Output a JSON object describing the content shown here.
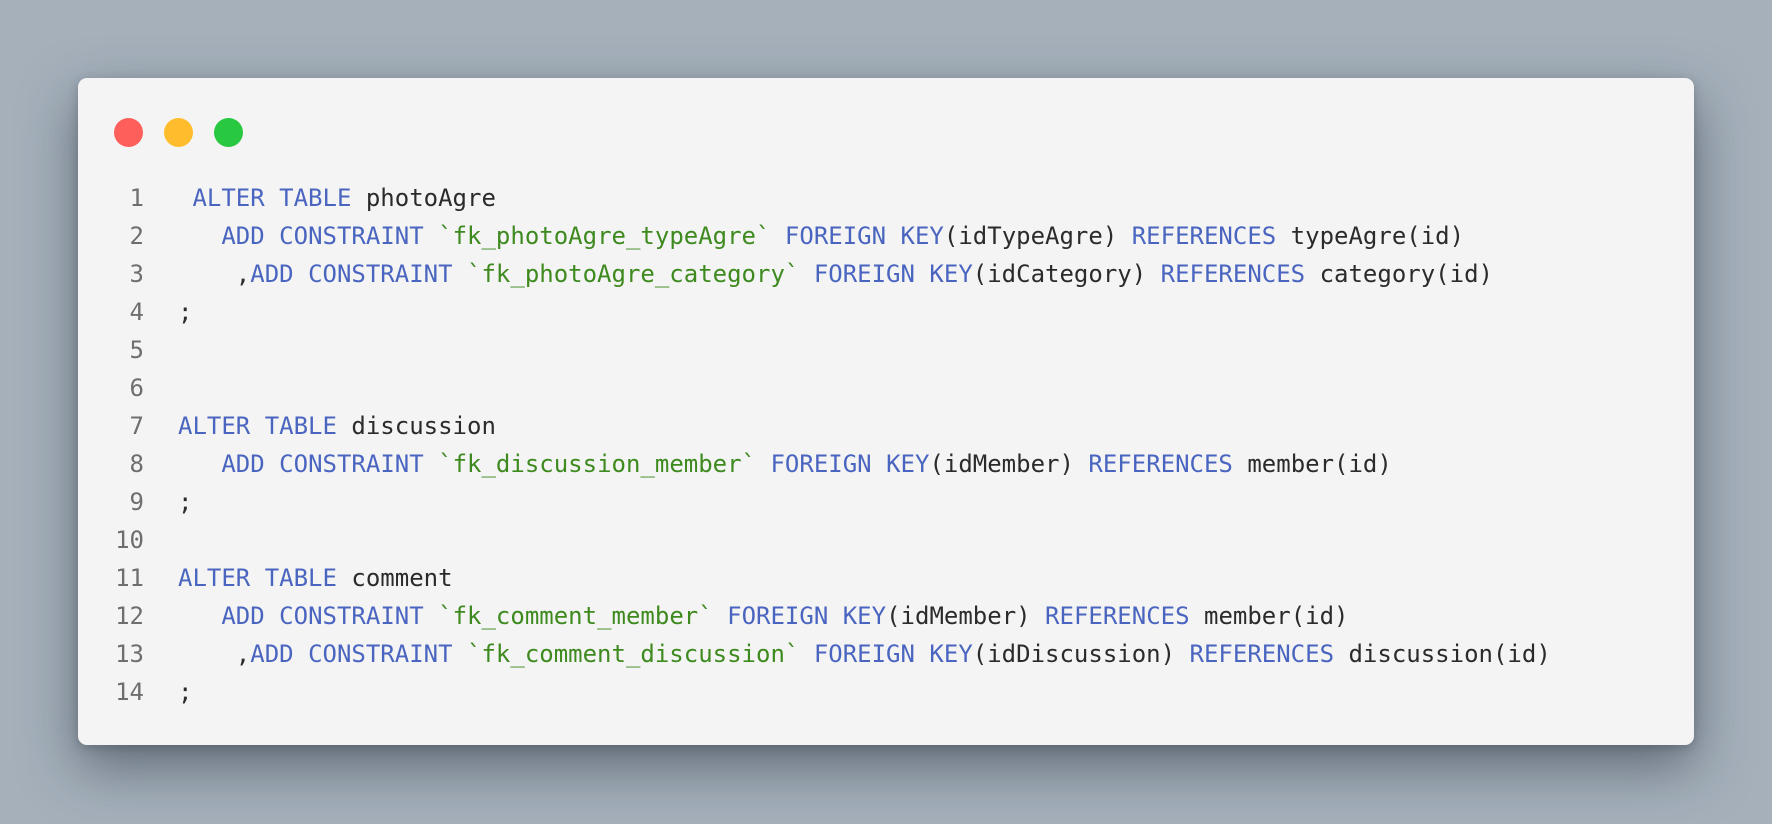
{
  "window": {
    "controls": [
      {
        "name": "close",
        "color": "#ff5f5a"
      },
      {
        "name": "minimize",
        "color": "#ffbd2e"
      },
      {
        "name": "maximize",
        "color": "#28c840"
      }
    ]
  },
  "colors": {
    "keyword": "#4a65c0",
    "string": "#3e8a1f",
    "identifier": "#2b2b2b",
    "line_number": "#6e6e6e",
    "editor_background": "#f4f4f4",
    "page_background": "#a5b0bb"
  },
  "code": {
    "lines": [
      {
        "number": "1",
        "tokens": [
          {
            "t": " "
          },
          {
            "t": "ALTER",
            "k": "kw"
          },
          {
            "t": " "
          },
          {
            "t": "TABLE",
            "k": "kw"
          },
          {
            "t": " photoAgre"
          }
        ]
      },
      {
        "number": "2",
        "tokens": [
          {
            "t": "   "
          },
          {
            "t": "ADD",
            "k": "kw"
          },
          {
            "t": " "
          },
          {
            "t": "CONSTRAINT",
            "k": "kw"
          },
          {
            "t": " "
          },
          {
            "t": "`fk_photoAgre_typeAgre`",
            "k": "str"
          },
          {
            "t": " "
          },
          {
            "t": "FOREIGN",
            "k": "kw"
          },
          {
            "t": " "
          },
          {
            "t": "KEY",
            "k": "kw"
          },
          {
            "t": "(idTypeAgre) "
          },
          {
            "t": "REFERENCES",
            "k": "kw"
          },
          {
            "t": " typeAgre(id)"
          }
        ]
      },
      {
        "number": "3",
        "tokens": [
          {
            "t": "    ,"
          },
          {
            "t": "ADD",
            "k": "kw"
          },
          {
            "t": " "
          },
          {
            "t": "CONSTRAINT",
            "k": "kw"
          },
          {
            "t": " "
          },
          {
            "t": "`fk_photoAgre_category`",
            "k": "str"
          },
          {
            "t": " "
          },
          {
            "t": "FOREIGN",
            "k": "kw"
          },
          {
            "t": " "
          },
          {
            "t": "KEY",
            "k": "kw"
          },
          {
            "t": "(idCategory) "
          },
          {
            "t": "REFERENCES",
            "k": "kw"
          },
          {
            "t": " category(id)"
          }
        ]
      },
      {
        "number": "4",
        "tokens": [
          {
            "t": ";"
          }
        ]
      },
      {
        "number": "5",
        "tokens": []
      },
      {
        "number": "6",
        "tokens": []
      },
      {
        "number": "7",
        "tokens": [
          {
            "t": "ALTER",
            "k": "kw"
          },
          {
            "t": " "
          },
          {
            "t": "TABLE",
            "k": "kw"
          },
          {
            "t": " discussion"
          }
        ]
      },
      {
        "number": "8",
        "tokens": [
          {
            "t": "   "
          },
          {
            "t": "ADD",
            "k": "kw"
          },
          {
            "t": " "
          },
          {
            "t": "CONSTRAINT",
            "k": "kw"
          },
          {
            "t": " "
          },
          {
            "t": "`fk_discussion_member`",
            "k": "str"
          },
          {
            "t": " "
          },
          {
            "t": "FOREIGN",
            "k": "kw"
          },
          {
            "t": " "
          },
          {
            "t": "KEY",
            "k": "kw"
          },
          {
            "t": "(idMember) "
          },
          {
            "t": "REFERENCES",
            "k": "kw"
          },
          {
            "t": " member(id)"
          }
        ]
      },
      {
        "number": "9",
        "tokens": [
          {
            "t": ";"
          }
        ]
      },
      {
        "number": "10",
        "tokens": []
      },
      {
        "number": "11",
        "tokens": [
          {
            "t": "ALTER",
            "k": "kw"
          },
          {
            "t": " "
          },
          {
            "t": "TABLE",
            "k": "kw"
          },
          {
            "t": " comment"
          }
        ]
      },
      {
        "number": "12",
        "tokens": [
          {
            "t": "   "
          },
          {
            "t": "ADD",
            "k": "kw"
          },
          {
            "t": " "
          },
          {
            "t": "CONSTRAINT",
            "k": "kw"
          },
          {
            "t": " "
          },
          {
            "t": "`fk_comment_member`",
            "k": "str"
          },
          {
            "t": " "
          },
          {
            "t": "FOREIGN",
            "k": "kw"
          },
          {
            "t": " "
          },
          {
            "t": "KEY",
            "k": "kw"
          },
          {
            "t": "(idMember) "
          },
          {
            "t": "REFERENCES",
            "k": "kw"
          },
          {
            "t": " member(id)"
          }
        ]
      },
      {
        "number": "13",
        "tokens": [
          {
            "t": "    ,"
          },
          {
            "t": "ADD",
            "k": "kw"
          },
          {
            "t": " "
          },
          {
            "t": "CONSTRAINT",
            "k": "kw"
          },
          {
            "t": " "
          },
          {
            "t": "`fk_comment_discussion`",
            "k": "str"
          },
          {
            "t": " "
          },
          {
            "t": "FOREIGN",
            "k": "kw"
          },
          {
            "t": " "
          },
          {
            "t": "KEY",
            "k": "kw"
          },
          {
            "t": "(idDiscussion) "
          },
          {
            "t": "REFERENCES",
            "k": "kw"
          },
          {
            "t": " discussion(id)"
          }
        ]
      },
      {
        "number": "14",
        "tokens": [
          {
            "t": ";"
          }
        ]
      }
    ]
  }
}
